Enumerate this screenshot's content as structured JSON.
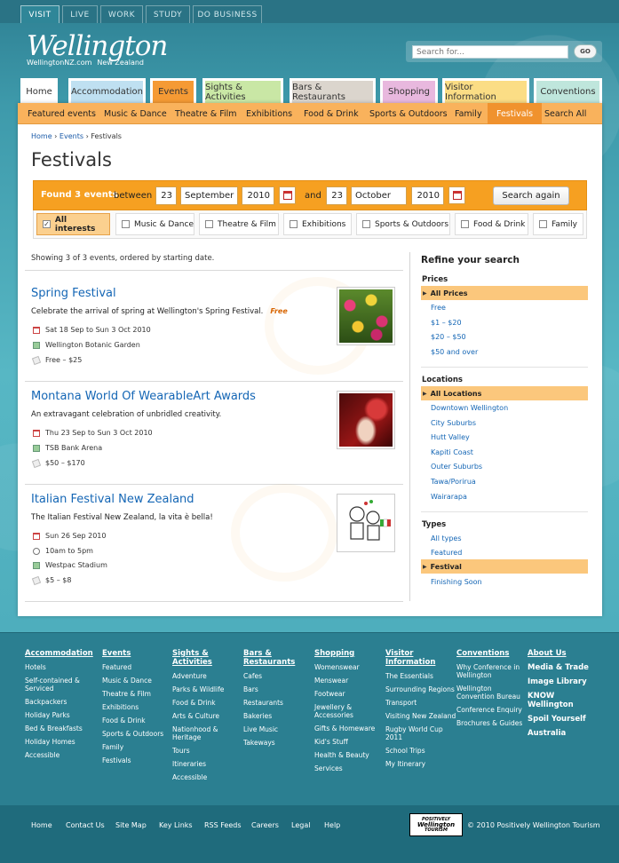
{
  "top_tabs": [
    "VISIT",
    "LIVE",
    "WORK",
    "STUDY",
    "DO BUSINESS"
  ],
  "logo": {
    "script": "Wellington",
    "site": "WellingtonNZ.com",
    "country": "New Zealand"
  },
  "search": {
    "placeholder": "Search for...",
    "go": "GO"
  },
  "nav": [
    {
      "label": "Home",
      "color": "#ffffff"
    },
    {
      "label": "Accommodation",
      "color": "#bfe0f1"
    },
    {
      "label": "Events",
      "color": "#f59a34"
    },
    {
      "label": "Sights & Activities",
      "color": "#c9e7a5"
    },
    {
      "label": "Bars & Restaurants",
      "color": "#dbd5cd"
    },
    {
      "label": "Shopping",
      "color": "#e8b8de"
    },
    {
      "label": "Visitor Information",
      "color": "#fbdd85"
    },
    {
      "label": "Conventions",
      "color": "#bfe6dc"
    }
  ],
  "subnav": [
    "Featured events",
    "Music & Dance",
    "Theatre & Film",
    "Exhibitions",
    "Food & Drink",
    "Sports & Outdoors",
    "Family",
    "Festivals",
    "Search All"
  ],
  "breadcrumb": {
    "home": "Home",
    "events": "Events",
    "current": "Festivals",
    "sep": "›"
  },
  "title": "Festivals",
  "filter": {
    "found": "Found 3 events",
    "between": "between",
    "from_day": "23",
    "from_month": "September",
    "from_year": "2010",
    "and": "and",
    "to_day": "23",
    "to_month": "October",
    "to_year": "2010",
    "button": "Search again"
  },
  "interests": [
    "All interests",
    "Music & Dance",
    "Theatre & Film",
    "Exhibitions",
    "Sports & Outdoors",
    "Food & Drink",
    "Family"
  ],
  "showing": "Showing 3 of 3 events, ordered by starting date.",
  "events": [
    {
      "title": "Spring Festival",
      "desc": "Celebrate the arrival of spring at Wellington's Spring Festival.",
      "free": "Free",
      "date": "Sat 18 Sep to Sun 3 Oct 2010",
      "venue": "Wellington Botanic Garden",
      "price": "Free – $25"
    },
    {
      "title": "Montana World Of WearableArt Awards",
      "desc": "An extravagant celebration of unbridled creativity.",
      "date": "Thu 23 Sep to Sun 3 Oct 2010",
      "venue": "TSB Bank Arena",
      "price": "$50 – $170"
    },
    {
      "title": "Italian Festival New Zealand",
      "desc": "The Italian Festival New Zealand, la vita è bella!",
      "date": "Sun 26 Sep 2010",
      "time": "10am to 5pm",
      "venue": "Westpac Stadium",
      "price": "$5 – $8"
    }
  ],
  "refine": {
    "title": "Refine your search",
    "prices_h": "Prices",
    "prices_active": "All Prices",
    "prices": [
      "Free",
      "$1 – $20",
      "$20 – $50",
      "$50 and over"
    ],
    "locations_h": "Locations",
    "locations_active": "All Locations",
    "locations": [
      "Downtown Wellington",
      "City Suburbs",
      "Hutt Valley",
      "Kapiti Coast",
      "Outer Suburbs",
      "Tawa/Porirua",
      "Wairarapa"
    ],
    "types_h": "Types",
    "types_before": [
      "All types",
      "Featured"
    ],
    "types_active": "Festival",
    "types_after": [
      "Finishing Soon"
    ]
  },
  "footer": [
    {
      "head": "Accommodation",
      "items": [
        "Hotels",
        "Self-contained & Serviced",
        "Backpackers",
        "Holiday Parks",
        "Bed & Breakfasts",
        "Holiday Homes",
        "Accessible"
      ]
    },
    {
      "head": "Events",
      "items": [
        "Featured",
        "Music & Dance",
        "Theatre & Film",
        "Exhibitions",
        "Food & Drink",
        "Sports & Outdoors",
        "Family",
        "Festivals"
      ]
    },
    {
      "head": "Sights & Activities",
      "items": [
        "Adventure",
        "Parks & Wildlife",
        "Food & Drink",
        "Arts & Culture",
        "Nationhood & Heritage",
        "Tours",
        "Itineraries",
        "Accessible"
      ]
    },
    {
      "head": "Bars & Restaurants",
      "items": [
        "Cafes",
        "Bars",
        "Restaurants",
        "Bakeries",
        "Live Music",
        "Takeways"
      ]
    },
    {
      "head": "Shopping",
      "items": [
        "Womenswear",
        "Menswear",
        "Footwear",
        "Jewellery & Accessories",
        "Gifts & Homeware",
        "Kid's Stuff",
        "Health & Beauty",
        "Services"
      ]
    },
    {
      "head": "Visitor Information",
      "items": [
        "The Essentials",
        "Surrounding Regions",
        "Transport",
        "Visiting New Zealand",
        "Rugby World Cup 2011",
        "School Trips",
        "My Itinerary"
      ]
    },
    {
      "head": "Conventions",
      "items": [
        "Why Conference in Wellington",
        "Wellington Convention Bureau",
        "Conference Enquiry",
        "Brochures & Guides"
      ]
    },
    {
      "head": "About Us",
      "items": [
        "Media & Trade",
        "Image Library",
        "KNOW Wellington",
        "Spoil Yourself",
        "Australia"
      ]
    }
  ],
  "bottom_links": [
    "Home",
    "Contact Us",
    "Site Map",
    "Key Links",
    "RSS Feeds",
    "Careers",
    "Legal",
    "Help"
  ],
  "pw_logo": [
    "POSITIVELY",
    "Wellington",
    "TOURISM"
  ],
  "copyright": "© 2010 Positively Wellington Tourism"
}
